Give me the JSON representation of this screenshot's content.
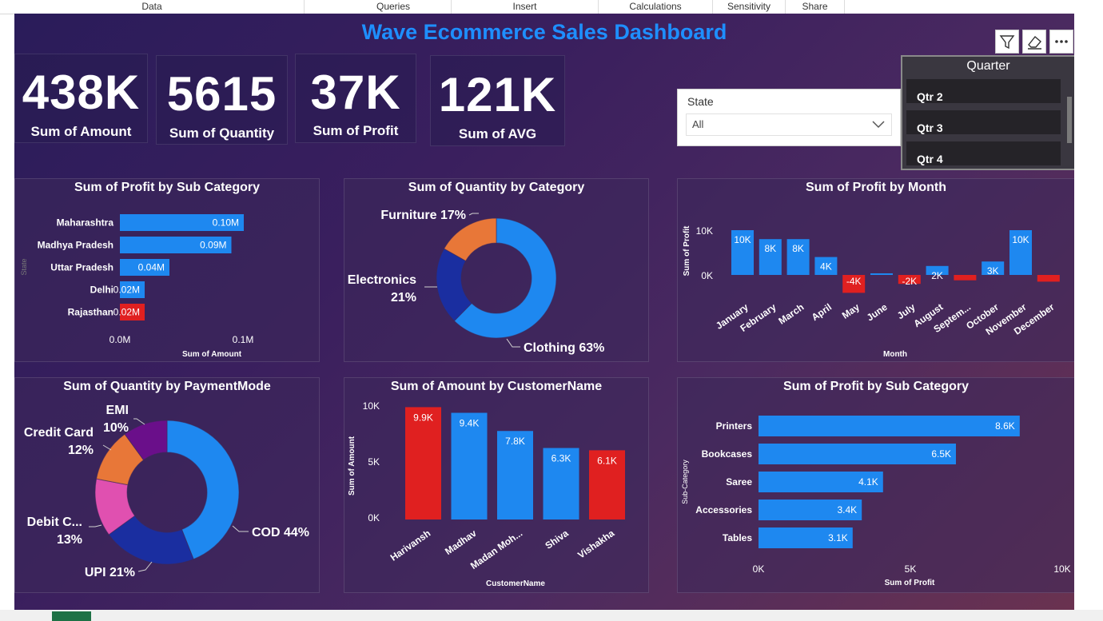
{
  "menu": [
    "Data",
    "Queries",
    "Insert",
    "Calculations",
    "Sensitivity",
    "Share"
  ],
  "dashboard": {
    "title": "Wave Ecommerce Sales Dashboard"
  },
  "kpis": [
    {
      "value": "438K",
      "label": "Sum of Amount"
    },
    {
      "value": "5615",
      "label": "Sum of Quantity"
    },
    {
      "value": "37K",
      "label": "Sum of Profit"
    },
    {
      "value": "121K",
      "label": "Sum of AVG"
    }
  ],
  "state_slicer": {
    "label": "State",
    "value": "All"
  },
  "quarter_slicer": {
    "title": "Quarter",
    "items": [
      "Qtr 2",
      "Qtr 3",
      "Qtr 4"
    ]
  },
  "toolbar": {
    "icons": [
      "filter-icon",
      "eraser-icon",
      "more-options-icon"
    ]
  },
  "colors": {
    "blue": "#1e88f0",
    "red": "#e02020",
    "orange": "#e87738",
    "navy": "#1a2ea0",
    "purple": "#6a0f8a",
    "pink": "#e050b0",
    "title": "#1e8fff"
  },
  "charts": [
    {
      "title": "Sum of Profit by Sub Category",
      "chart_data": {
        "type": "bar",
        "orientation": "horizontal",
        "categories": [
          "Maharashtra",
          "Madhya Pradesh",
          "Uttar Pradesh",
          "Delhi",
          "Rajasthan"
        ],
        "values": [
          0.1,
          0.09,
          0.04,
          0.02,
          0.02
        ],
        "labels": [
          "0.10M",
          "0.09M",
          "0.04M",
          "0.02M",
          "0.02M"
        ],
        "colors": [
          "#1e88f0",
          "#1e88f0",
          "#1e88f0",
          "#1e88f0",
          "#e02020"
        ],
        "xlabel": "Sum of Amount",
        "ylabel": "State",
        "xticks": [
          "0.0M",
          "0.1M"
        ],
        "xlim": [
          0,
          0.14
        ]
      }
    },
    {
      "title": "Sum of Quantity by Category",
      "chart_data": {
        "type": "pie",
        "donut": true,
        "slices": [
          {
            "label": "Clothing 63%",
            "value": 63,
            "color": "#1e88f0"
          },
          {
            "label": "Electronics 21%",
            "value": 21,
            "color": "#1a2ea0"
          },
          {
            "label": "Furniture 17%",
            "value": 17,
            "color": "#e87738"
          }
        ]
      }
    },
    {
      "title": "Sum of Profit by Month",
      "chart_data": {
        "type": "bar",
        "subtype": "waterfall",
        "categories": [
          "January",
          "February",
          "March",
          "April",
          "May",
          "June",
          "July",
          "August",
          "Septem...",
          "October",
          "November",
          "December"
        ],
        "values": [
          10,
          8,
          8,
          4,
          -4,
          0.3,
          -2,
          2,
          -1.2,
          3,
          10,
          -1.5
        ],
        "labels": [
          "10K",
          "8K",
          "8K",
          "4K",
          "-4K",
          "",
          "-2K",
          "2K",
          "",
          "3K",
          "10K",
          ""
        ],
        "xlabel": "Month",
        "ylabel": "Sum of Profit",
        "yticks": [
          "10K",
          "0K"
        ],
        "ylim": [
          -5,
          12
        ]
      }
    },
    {
      "title": "Sum of Quantity by PaymentMode",
      "chart_data": {
        "type": "pie",
        "donut": true,
        "slices": [
          {
            "label": "COD 44%",
            "value": 44,
            "color": "#1e88f0"
          },
          {
            "label": "UPI 21%",
            "value": 21,
            "color": "#1a2ea0"
          },
          {
            "label": "Debit C... 13%",
            "value": 13,
            "color": "#e050b0"
          },
          {
            "label": "Credit Card 12%",
            "value": 12,
            "color": "#e87738"
          },
          {
            "label": "EMI 10%",
            "value": 10,
            "color": "#6a0f8a"
          }
        ]
      }
    },
    {
      "title": "Sum of Amount by CustomerName",
      "chart_data": {
        "type": "bar",
        "orientation": "vertical",
        "categories": [
          "Harivansh",
          "Madhav",
          "Madan Moh...",
          "Shiva",
          "Vishakha"
        ],
        "values": [
          9.9,
          9.4,
          7.8,
          6.3,
          6.1
        ],
        "labels": [
          "9.9K",
          "9.4K",
          "7.8K",
          "6.3K",
          "6.1K"
        ],
        "colors": [
          "#e02020",
          "#1e88f0",
          "#1e88f0",
          "#1e88f0",
          "#e02020"
        ],
        "xlabel": "CustomerName",
        "ylabel": "Sum of Amount",
        "yticks": [
          "10K",
          "5K",
          "0K"
        ],
        "ylim": [
          0,
          10
        ]
      }
    },
    {
      "title": "Sum of Profit by Sub Category",
      "chart_data": {
        "type": "bar",
        "orientation": "horizontal",
        "categories": [
          "Printers",
          "Bookcases",
          "Saree",
          "Accessories",
          "Tables"
        ],
        "values": [
          8.6,
          6.5,
          4.1,
          3.4,
          3.1
        ],
        "labels": [
          "8.6K",
          "6.5K",
          "4.1K",
          "3.4K",
          "3.1K"
        ],
        "colors": [
          "#1e88f0",
          "#1e88f0",
          "#1e88f0",
          "#1e88f0",
          "#1e88f0"
        ],
        "xlabel": "Sum of Profit",
        "ylabel": "Sub-Category",
        "xticks": [
          "0K",
          "5K",
          "10K"
        ],
        "xlim": [
          0,
          10
        ]
      }
    }
  ]
}
